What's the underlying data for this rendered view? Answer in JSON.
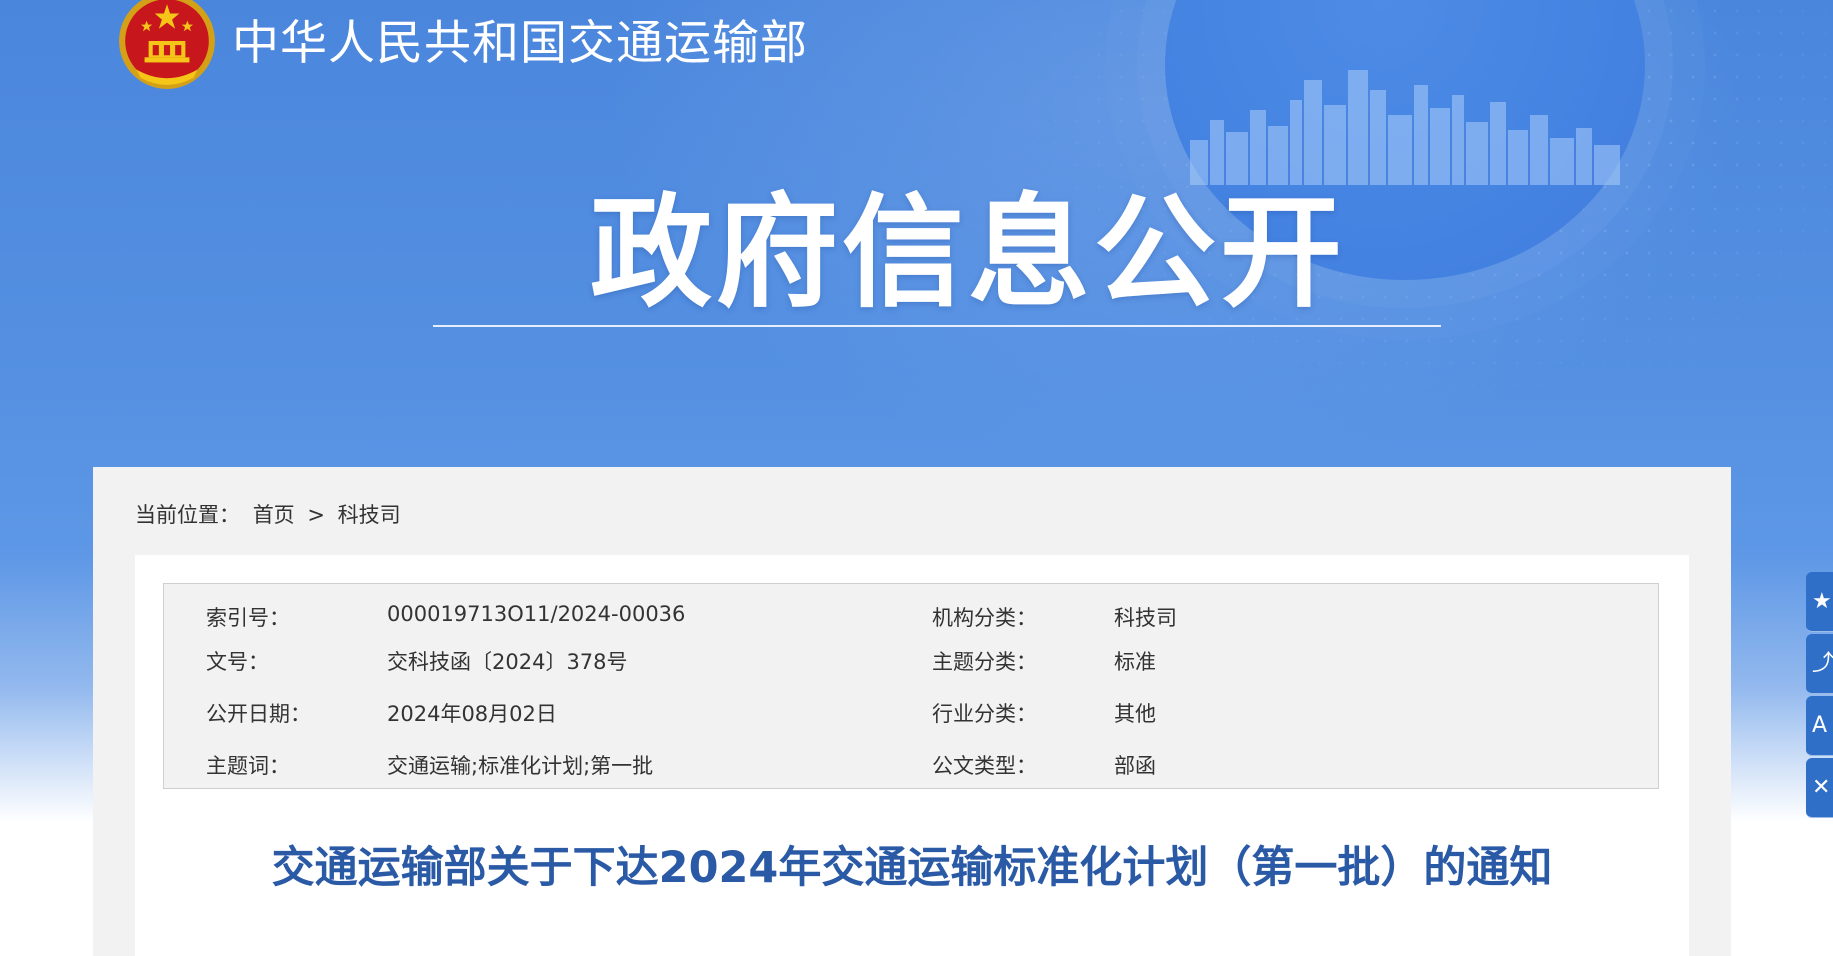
{
  "header": {
    "ministry_name": "中华人民共和国交通运输部",
    "section_title": "政府信息公开"
  },
  "breadcrumb": {
    "label": "当前位置：",
    "items": [
      "首页",
      ">",
      "科技司"
    ]
  },
  "metadata": {
    "rows": [
      {
        "k1": "索引号：",
        "v1": "000019713O11/2024-00036",
        "k2": "机构分类：",
        "v2": "科技司"
      },
      {
        "k1": "文号：",
        "v1": "交科技函〔2024〕378号",
        "k2": "主题分类：",
        "v2": "标准"
      },
      {
        "k1": "公开日期：",
        "v1": "2024年08月02日",
        "k2": "行业分类：",
        "v2": "其他"
      },
      {
        "k1": "主题词：",
        "v1": "交通运输;标准化计划;第一批",
        "k2": "公文类型：",
        "v2": "部函"
      }
    ]
  },
  "document": {
    "title": "交通运输部关于下达2024年交通运输标准化计划（第一批）的通知"
  },
  "side_tools": [
    "star-icon",
    "share-icon",
    "font-size-icon",
    "close-icon"
  ],
  "colors": {
    "banner_blue": "#4a86dc",
    "title_blue": "#2a5aa6",
    "side_button": "#2f6fc8"
  }
}
